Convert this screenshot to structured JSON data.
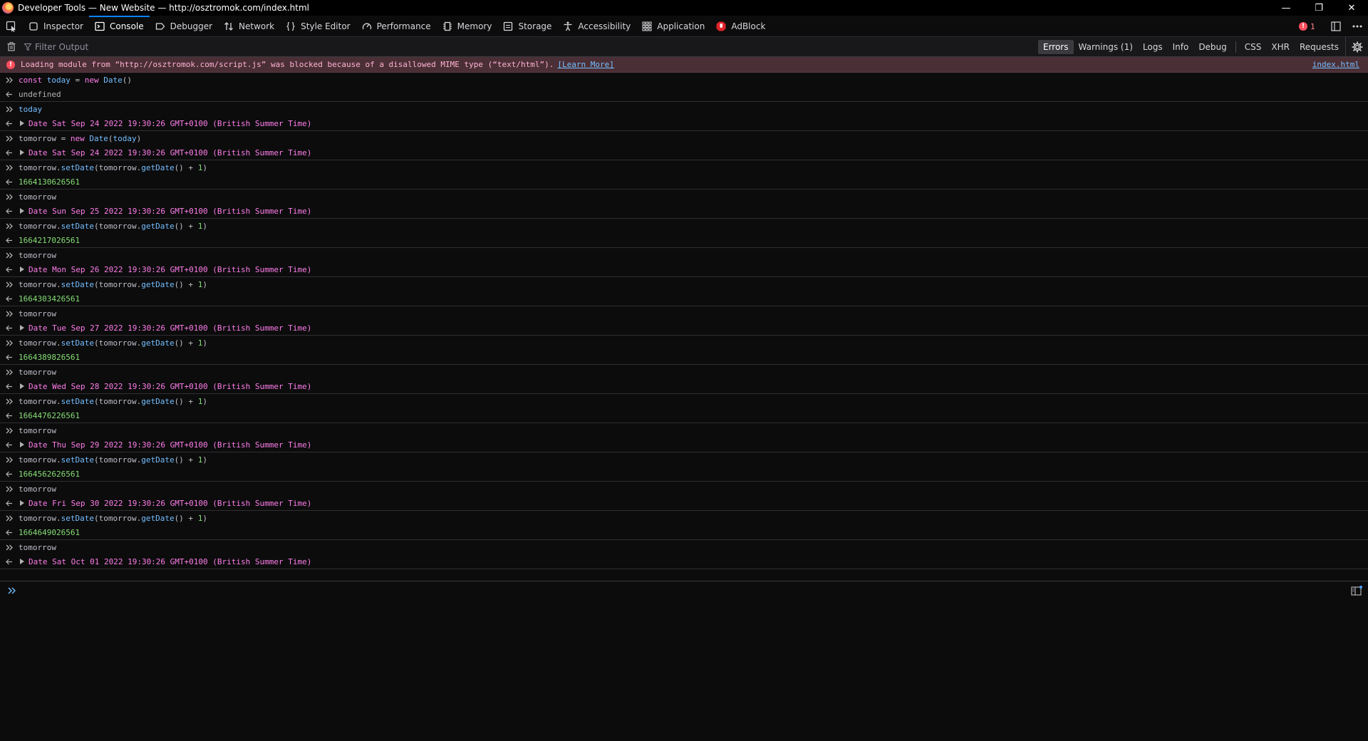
{
  "window": {
    "title": "Developer Tools — New Website — http://osztromok.com/index.html",
    "buttons": {
      "minimize": "—",
      "restore": "❐",
      "close": "✕"
    }
  },
  "toolbar": {
    "tabs": [
      {
        "label": "Inspector",
        "icon": "inspector-icon"
      },
      {
        "label": "Console",
        "icon": "console-icon",
        "active": true
      },
      {
        "label": "Debugger",
        "icon": "debugger-icon"
      },
      {
        "label": "Network",
        "icon": "network-icon"
      },
      {
        "label": "Style Editor",
        "icon": "style-editor-icon"
      },
      {
        "label": "Performance",
        "icon": "performance-icon"
      },
      {
        "label": "Memory",
        "icon": "memory-icon"
      },
      {
        "label": "Storage",
        "icon": "storage-icon"
      },
      {
        "label": "Accessibility",
        "icon": "accessibility-icon"
      },
      {
        "label": "Application",
        "icon": "application-icon"
      },
      {
        "label": "AdBlock",
        "icon": "adblock-icon"
      }
    ],
    "error_count": "1",
    "error_badge": "!"
  },
  "filter": {
    "placeholder": "Filter Output",
    "levels": [
      "Errors",
      "Warnings (1)",
      "Logs",
      "Info",
      "Debug"
    ],
    "active_level": "Errors",
    "requests": [
      "CSS",
      "XHR",
      "Requests"
    ]
  },
  "error_message": {
    "badge": "!",
    "text": "Loading module from “http://osztromok.com/script.js” was blocked because of a disallowed MIME type (“text/html”).",
    "learn_more": "[Learn More]",
    "source": "index.html"
  },
  "console": {
    "entries": [
      {
        "input": "const today = new Date()",
        "result": "undefined",
        "type": "undefined"
      },
      {
        "input": "today",
        "result": "Date Sat Sep 24 2022 19:30:26 GMT+0100 (British Summer Time)",
        "type": "object"
      },
      {
        "input": "tomorrow = new Date(today)",
        "result": "Date Sat Sep 24 2022 19:30:26 GMT+0100 (British Summer Time)",
        "type": "object"
      },
      {
        "input": "tomorrow.setDate(tomorrow.getDate() + 1)",
        "result": "1664130626561",
        "type": "number"
      },
      {
        "input": "tomorrow",
        "result": "Date Sun Sep 25 2022 19:30:26 GMT+0100 (British Summer Time)",
        "type": "object"
      },
      {
        "input": "tomorrow.setDate(tomorrow.getDate() + 1)",
        "result": "1664217026561",
        "type": "number"
      },
      {
        "input": "tomorrow",
        "result": "Date Mon Sep 26 2022 19:30:26 GMT+0100 (British Summer Time)",
        "type": "object"
      },
      {
        "input": "tomorrow.setDate(tomorrow.getDate() + 1)",
        "result": "1664303426561",
        "type": "number"
      },
      {
        "input": "tomorrow",
        "result": "Date Tue Sep 27 2022 19:30:26 GMT+0100 (British Summer Time)",
        "type": "object"
      },
      {
        "input": "tomorrow.setDate(tomorrow.getDate() + 1)",
        "result": "1664389826561",
        "type": "number"
      },
      {
        "input": "tomorrow",
        "result": "Date Wed Sep 28 2022 19:30:26 GMT+0100 (British Summer Time)",
        "type": "object"
      },
      {
        "input": "tomorrow.setDate(tomorrow.getDate() + 1)",
        "result": "1664476226561",
        "type": "number"
      },
      {
        "input": "tomorrow",
        "result": "Date Thu Sep 29 2022 19:30:26 GMT+0100 (British Summer Time)",
        "type": "object"
      },
      {
        "input": "tomorrow.setDate(tomorrow.getDate() + 1)",
        "result": "1664562626561",
        "type": "number"
      },
      {
        "input": "tomorrow",
        "result": "Date Fri Sep 30 2022 19:30:26 GMT+0100 (British Summer Time)",
        "type": "object"
      },
      {
        "input": "tomorrow.setDate(tomorrow.getDate() + 1)",
        "result": "1664649026561",
        "type": "number"
      },
      {
        "input": "tomorrow",
        "result": "Date Sat Oct 01 2022 19:30:26 GMT+0100 (British Summer Time)",
        "type": "object"
      }
    ]
  },
  "colors": {
    "accent": "#0a84ff",
    "error_bg": "#4b2f36",
    "number": "#86de74",
    "object": "#ff7de9"
  }
}
